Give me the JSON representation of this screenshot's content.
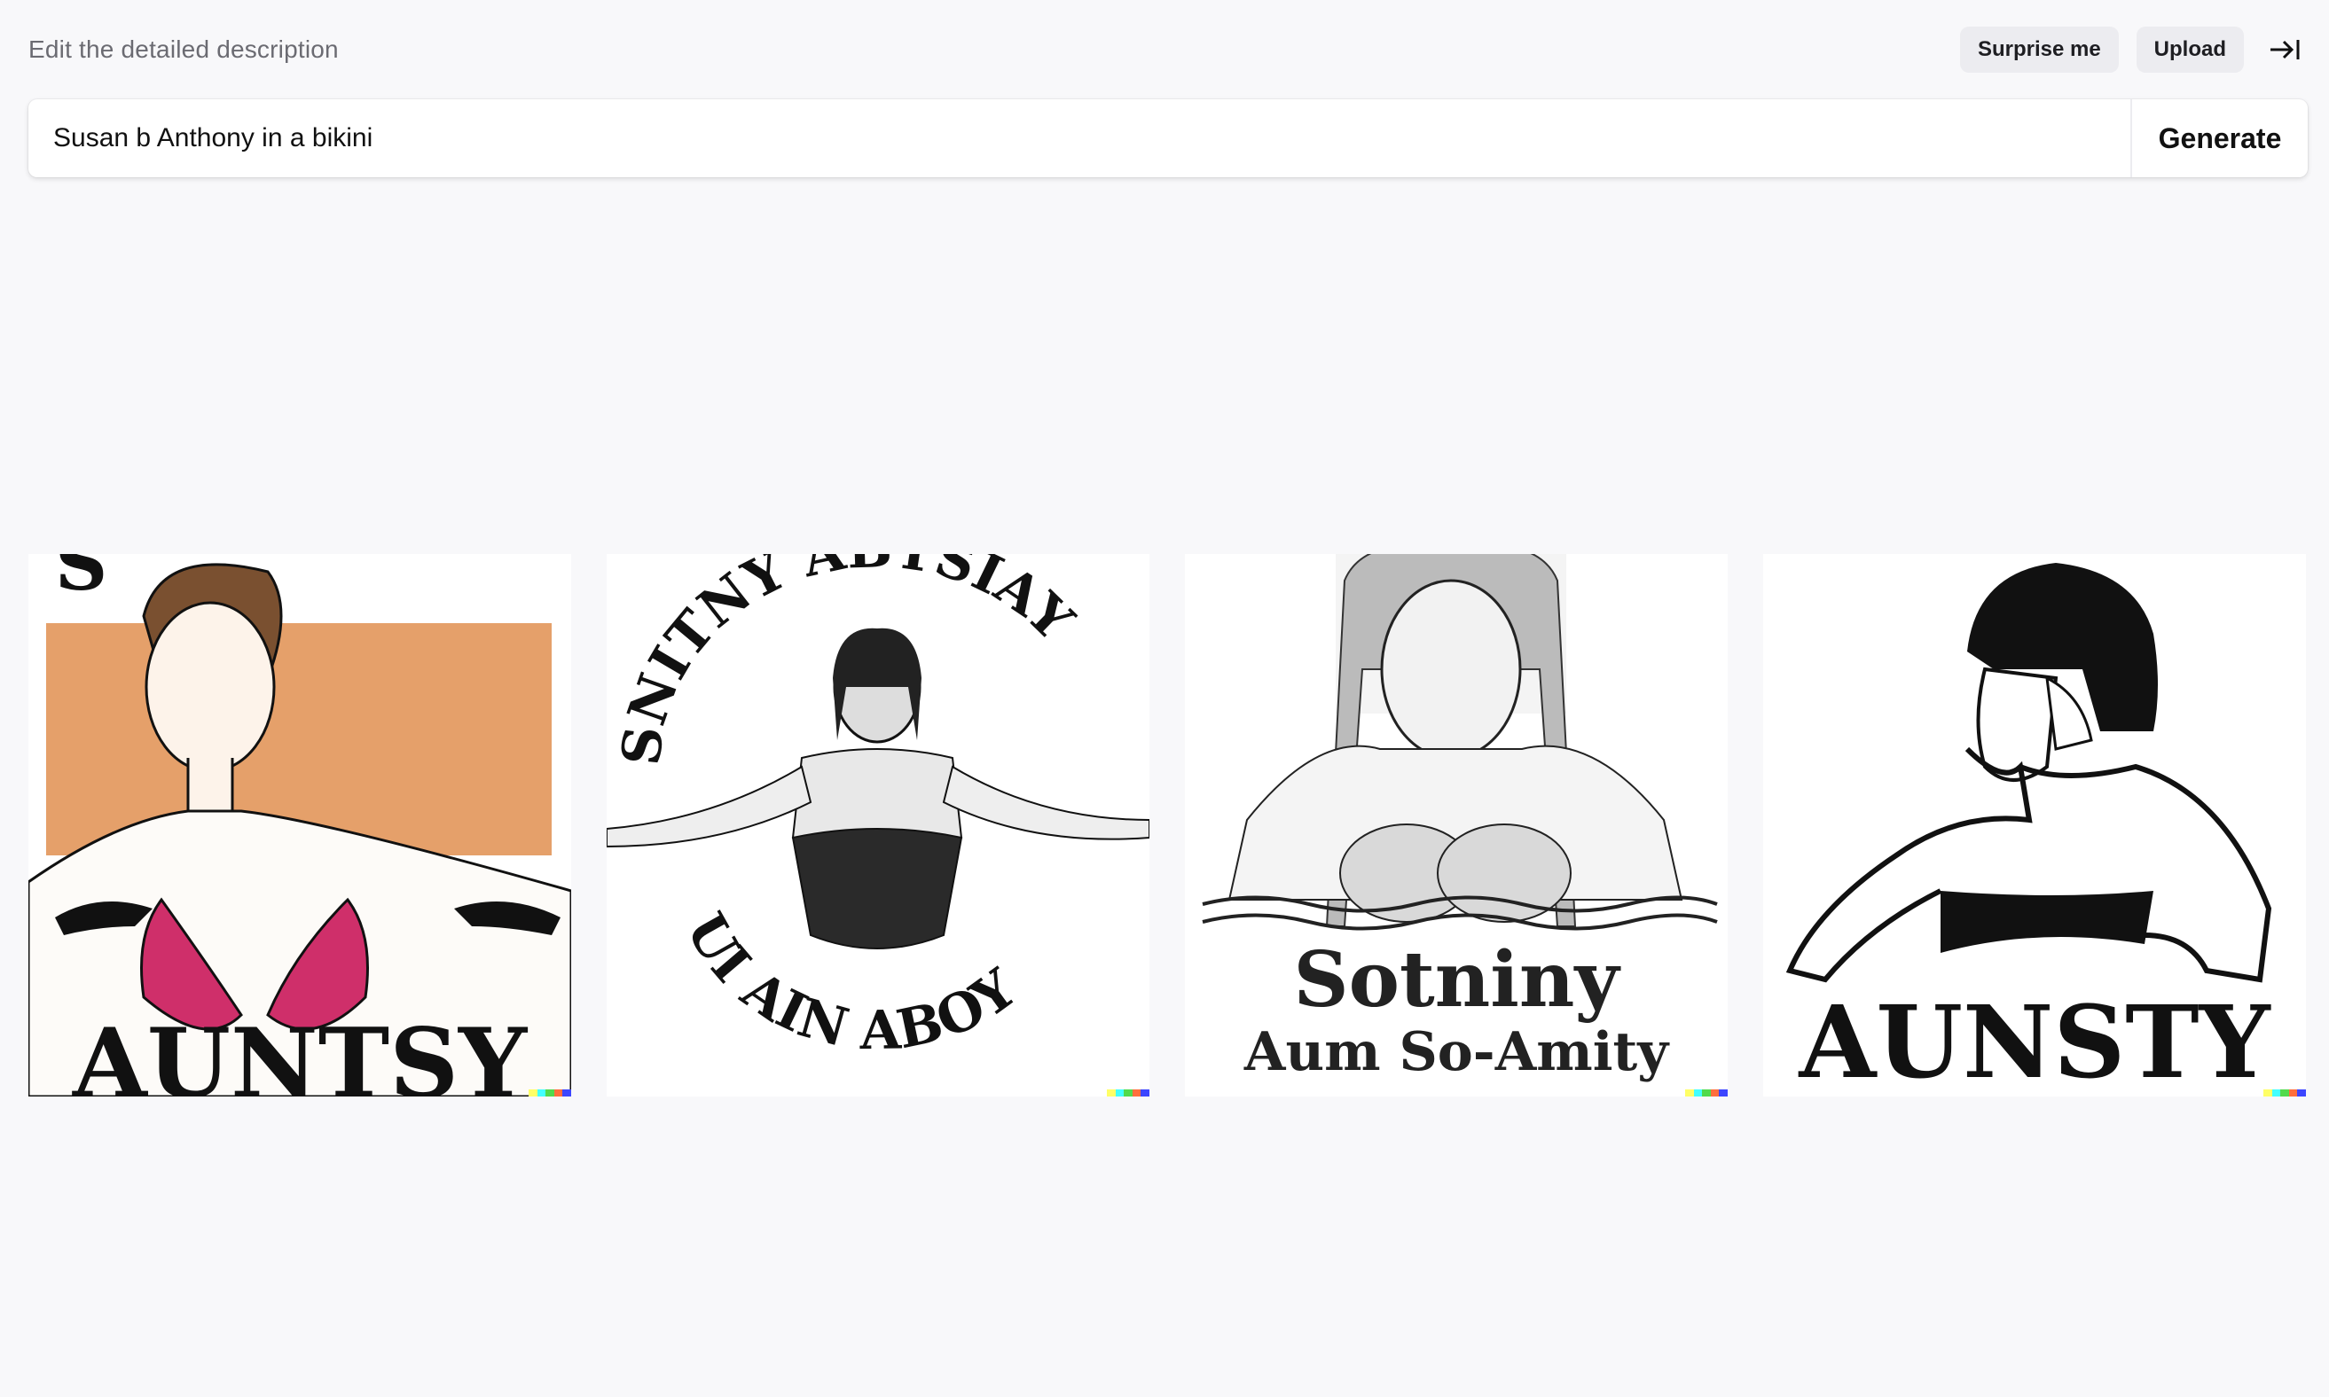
{
  "header": {
    "hint": "Edit the detailed description",
    "surprise_label": "Surprise me",
    "upload_label": "Upload",
    "collapse_icon": "arrow-right-to-bar-icon"
  },
  "prompt": {
    "value": "Susan b Anthony in a bikini",
    "generate_label": "Generate"
  },
  "images": [
    {
      "caption_top": "S",
      "caption_bottom": "AUNTSY"
    },
    {
      "caption_top": "SNITNY ABTSIAY",
      "caption_bottom": "UI AIN ABOY"
    },
    {
      "caption_top": "",
      "caption_bottom": "Sotniny",
      "caption_bottom_2": "Aum So-Amity"
    },
    {
      "caption_top": "",
      "caption_bottom": "AUNSTY"
    }
  ],
  "watermark_colors": [
    "#ffff66",
    "#42ffff",
    "#51da4c",
    "#ff6e3c",
    "#3c46ff"
  ]
}
